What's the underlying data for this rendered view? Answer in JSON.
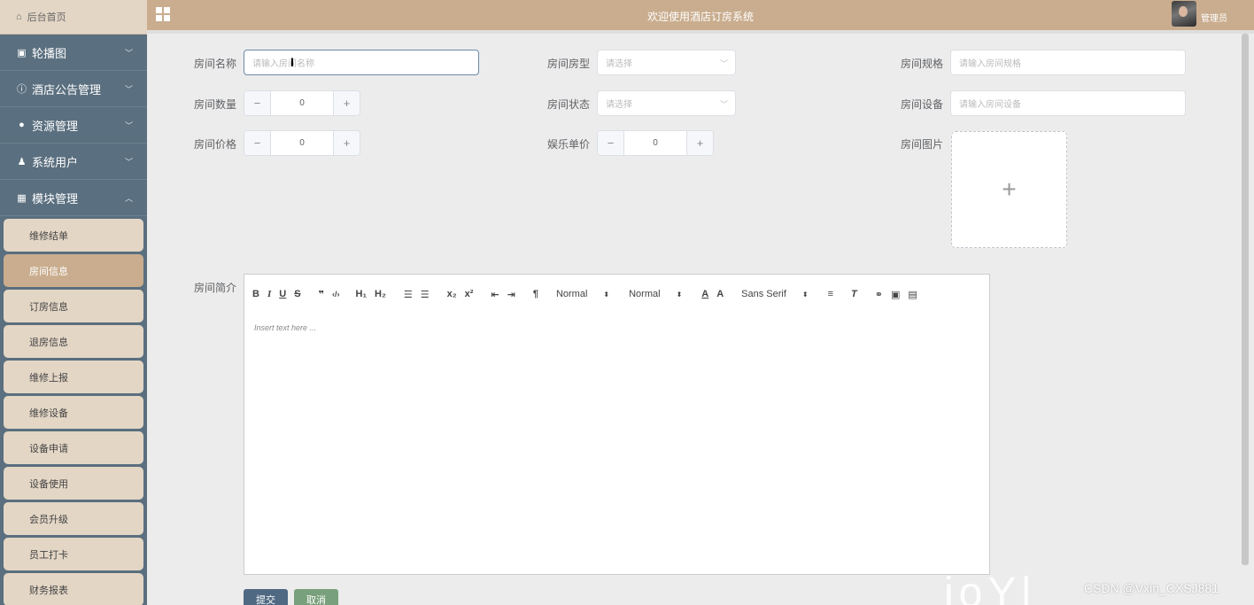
{
  "header": {
    "title": "欢迎使用酒店订房系统",
    "user_name": "管理员"
  },
  "sidebar": {
    "home_label": "后台首页",
    "menu": [
      {
        "label": "轮播图",
        "icon": "image-icon",
        "expanded": false
      },
      {
        "label": "酒店公告管理",
        "icon": "info-icon",
        "expanded": false
      },
      {
        "label": "资源管理",
        "icon": "bulb-icon",
        "expanded": false
      },
      {
        "label": "系统用户",
        "icon": "user-icon",
        "expanded": false
      },
      {
        "label": "模块管理",
        "icon": "grid-icon",
        "expanded": true
      }
    ],
    "submenu": [
      "维修结单",
      "房间信息",
      "订房信息",
      "退房信息",
      "维修上报",
      "维修设备",
      "设备申请",
      "设备使用",
      "会员升级",
      "员工打卡",
      "财务报表"
    ],
    "active_submenu": "房间信息"
  },
  "form": {
    "room_name": {
      "label": "房间名称",
      "placeholder": "请输入房间名称"
    },
    "room_type": {
      "label": "房间房型",
      "placeholder": "请选择"
    },
    "room_spec": {
      "label": "房间规格",
      "placeholder": "请输入房间规格"
    },
    "room_count": {
      "label": "房间数量",
      "value": "0"
    },
    "room_status": {
      "label": "房间状态",
      "placeholder": "请选择"
    },
    "room_equipment": {
      "label": "房间设备",
      "placeholder": "请输入房间设备"
    },
    "room_price": {
      "label": "房间价格",
      "value": "0"
    },
    "entertainment_price": {
      "label": "娱乐单价",
      "value": "0"
    },
    "room_image": {
      "label": "房间图片"
    },
    "room_intro": {
      "label": "房间简介",
      "placeholder": "Insert text here ..."
    }
  },
  "editor": {
    "header_select": "Normal",
    "size_select": "Normal",
    "font_select": "Sans Serif"
  },
  "actions": {
    "submit": "提交",
    "cancel": "取消"
  },
  "watermark": "CSDN @Vxin_CXSJ881",
  "colors": {
    "sidebar": "#5a6f7f",
    "header": "#c9ad8e",
    "submenu": "#e3d6c5",
    "submit": "#4f6983",
    "cancel": "#79a07c"
  }
}
